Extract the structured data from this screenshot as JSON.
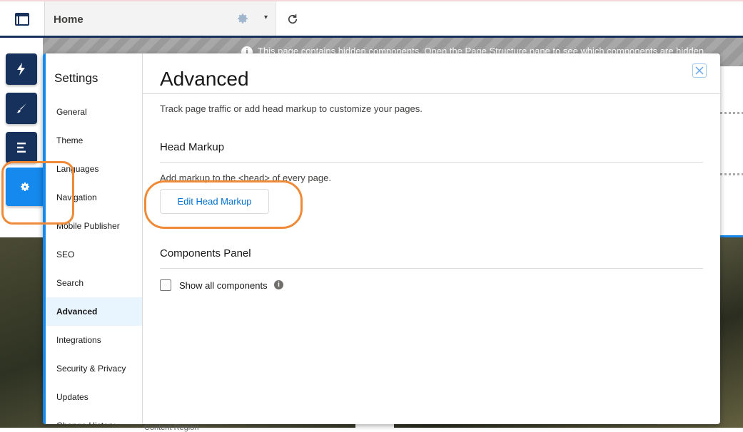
{
  "topbar": {
    "home_label": "Home",
    "menu_icon": "layout-icon",
    "settings_icon": "gear-icon",
    "caret": "▾",
    "refresh_icon": "refresh-icon"
  },
  "notice": {
    "text": "This page contains hidden components. Open the Page Structure pane to see which components are hidden."
  },
  "rail": {
    "items": [
      "lightning-icon",
      "paintbrush-icon",
      "list-icon",
      "gear-icon"
    ],
    "active_index": 3
  },
  "settings": {
    "title": "Settings",
    "nav_items": [
      "General",
      "Theme",
      "Languages",
      "Navigation",
      "Mobile Publisher",
      "SEO",
      "Search",
      "Advanced",
      "Integrations",
      "Security & Privacy",
      "Updates",
      "Change History"
    ],
    "selected": "Advanced"
  },
  "advanced": {
    "heading": "Advanced",
    "description": "Track page traffic or add head markup to customize your pages.",
    "head_markup_title": "Head Markup",
    "head_markup_desc": "Add markup to the <head> of every page.",
    "edit_button": "Edit Head Markup",
    "components_title": "Components Panel",
    "show_all_label": "Show all components",
    "show_all_checked": false
  },
  "colors": {
    "accent": "#1589ee",
    "nav_dark": "#16325c",
    "highlight": "#f08a36",
    "link": "#0070d2"
  },
  "background": {
    "bottom_text": "Content Region"
  }
}
